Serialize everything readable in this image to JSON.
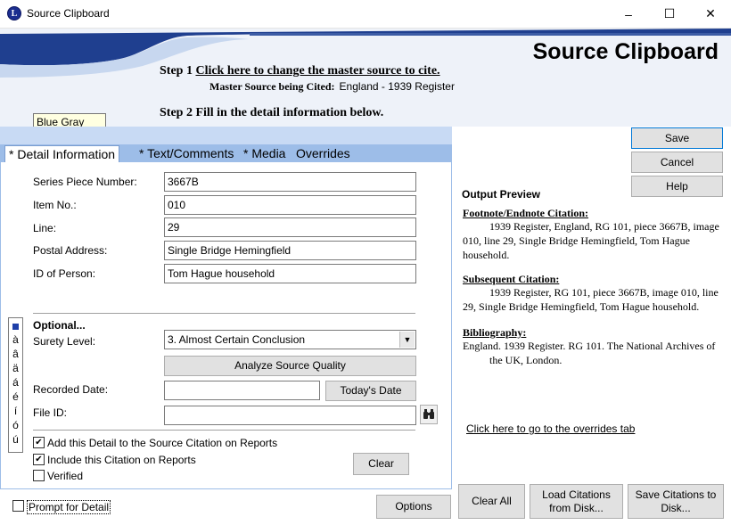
{
  "window": {
    "title": "Source Clipboard",
    "app_icon": "L",
    "minimize_icon": "–",
    "maximize_icon": "☐",
    "close_icon": "✕"
  },
  "header": {
    "title": "Source Clipboard",
    "step1_prefix": "Step 1",
    "step1_link": "Click here to change the master source to cite.",
    "master_label": "Master Source being Cited:",
    "master_value": "England - 1939 Register",
    "step2": "Step 2 Fill in the detail information below."
  },
  "tooltip": "Blue Gray",
  "tabs": [
    {
      "label": "* Detail Information",
      "active": true
    },
    {
      "label": "* Text/Comments"
    },
    {
      "label": "* Media"
    },
    {
      "label": "Overrides"
    }
  ],
  "fields": {
    "series_piece_label": "Series Piece Number:",
    "series_piece_value": "3667B",
    "item_no_label": "Item No.:",
    "item_no_value": "010",
    "line_label": "Line:",
    "line_value": "29",
    "postal_label": "Postal Address:",
    "postal_value": "Single Bridge Hemingfield",
    "id_label": "ID of Person:",
    "id_value": "Tom Hague household"
  },
  "optional": {
    "heading": "Optional...",
    "surety_label": "Surety Level:",
    "surety_value": "3.  Almost Certain Conclusion",
    "analyze_button": "Analyze Source Quality",
    "recorded_date_label": "Recorded Date:",
    "recorded_date_value": "",
    "todays_date_button": "Today's Date",
    "file_id_label": "File ID:",
    "file_id_value": "",
    "binoculars_icon": "binoculars-icon"
  },
  "checkboxes": {
    "add_detail": "Add this Detail to the Source Citation on Reports",
    "include_citation": "Include this Citation on Reports",
    "verified": "Verified",
    "prompt_for_detail": "Prompt for Detail"
  },
  "side_chars": [
    "à",
    "â",
    "ä",
    "á",
    "é",
    "í",
    "ó",
    "ú"
  ],
  "buttons": {
    "clear": "Clear",
    "options": "Options",
    "save": "Save",
    "cancel": "Cancel",
    "help": "Help",
    "clear_all": "Clear All",
    "load_citations": "Load Citations from Disk...",
    "save_citations": "Save Citations to Disk..."
  },
  "preview": {
    "heading": "Output Preview",
    "footnote_heading": "Footnote/Endnote Citation:",
    "footnote_text": "1939 Register, England, RG 101, piece 3667B, image 010, line 29, Single Bridge Hemingfield, Tom Hague household.",
    "subsequent_heading": "Subsequent Citation:",
    "subsequent_text": "1939 Register, RG 101, piece 3667B, image 010, line 29, Single Bridge Hemingfield, Tom Hague household.",
    "bibliography_heading": "Bibliography:",
    "bibliography_text": "England.  1939 Register. RG 101. The National Archives of the UK, London.",
    "overrides_link": "Click here to go to the overrides tab"
  }
}
